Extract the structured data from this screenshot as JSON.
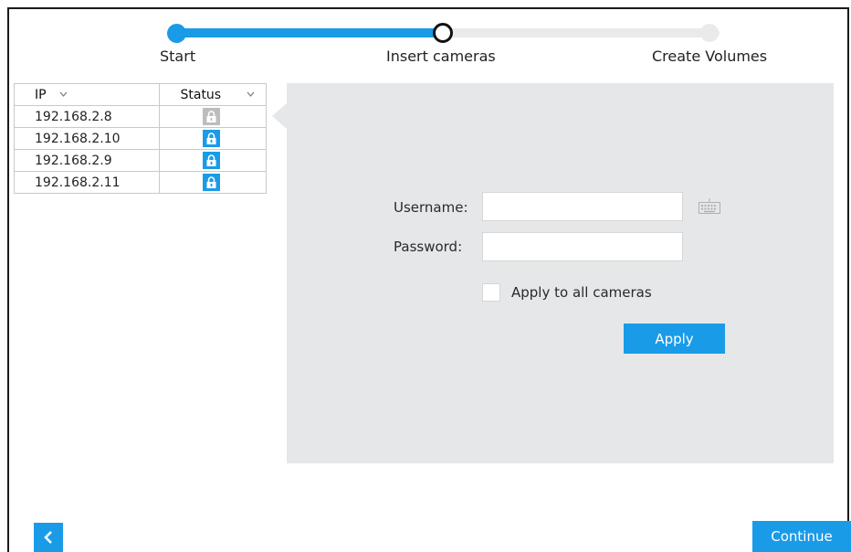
{
  "stepper": {
    "steps": [
      {
        "label": "Start",
        "state": "done"
      },
      {
        "label": "Insert cameras",
        "state": "current"
      },
      {
        "label": "Create Volumes",
        "state": "pending"
      }
    ]
  },
  "camera_table": {
    "columns": [
      {
        "label": "IP",
        "icon": "chevron-down-icon"
      },
      {
        "label": "Status",
        "icon": "chevron-down-icon"
      }
    ],
    "rows": [
      {
        "ip": "192.168.2.8",
        "status_icon": "lock-icon",
        "status_color": "#bdbdbd"
      },
      {
        "ip": "192.168.2.10",
        "status_icon": "lock-icon",
        "status_color": "#1a9be8"
      },
      {
        "ip": "192.168.2.9",
        "status_icon": "lock-icon",
        "status_color": "#1a9be8"
      },
      {
        "ip": "192.168.2.11",
        "status_icon": "lock-icon",
        "status_color": "#1a9be8"
      }
    ]
  },
  "credentials": {
    "username_label": "Username:",
    "username_value": "",
    "password_label": "Password:",
    "password_value": "",
    "keyboard_icon": "keyboard-icon",
    "apply_all_label": "Apply to all cameras",
    "apply_all_checked": false,
    "apply_button": "Apply"
  },
  "footer": {
    "back_icon": "chevron-left-icon",
    "continue_button": "Continue"
  },
  "colors": {
    "accent": "#1a9be8",
    "panel_bg": "#e6e7e8",
    "track_inactive": "#e9eaeb",
    "lock_inactive": "#bdbdbd"
  }
}
